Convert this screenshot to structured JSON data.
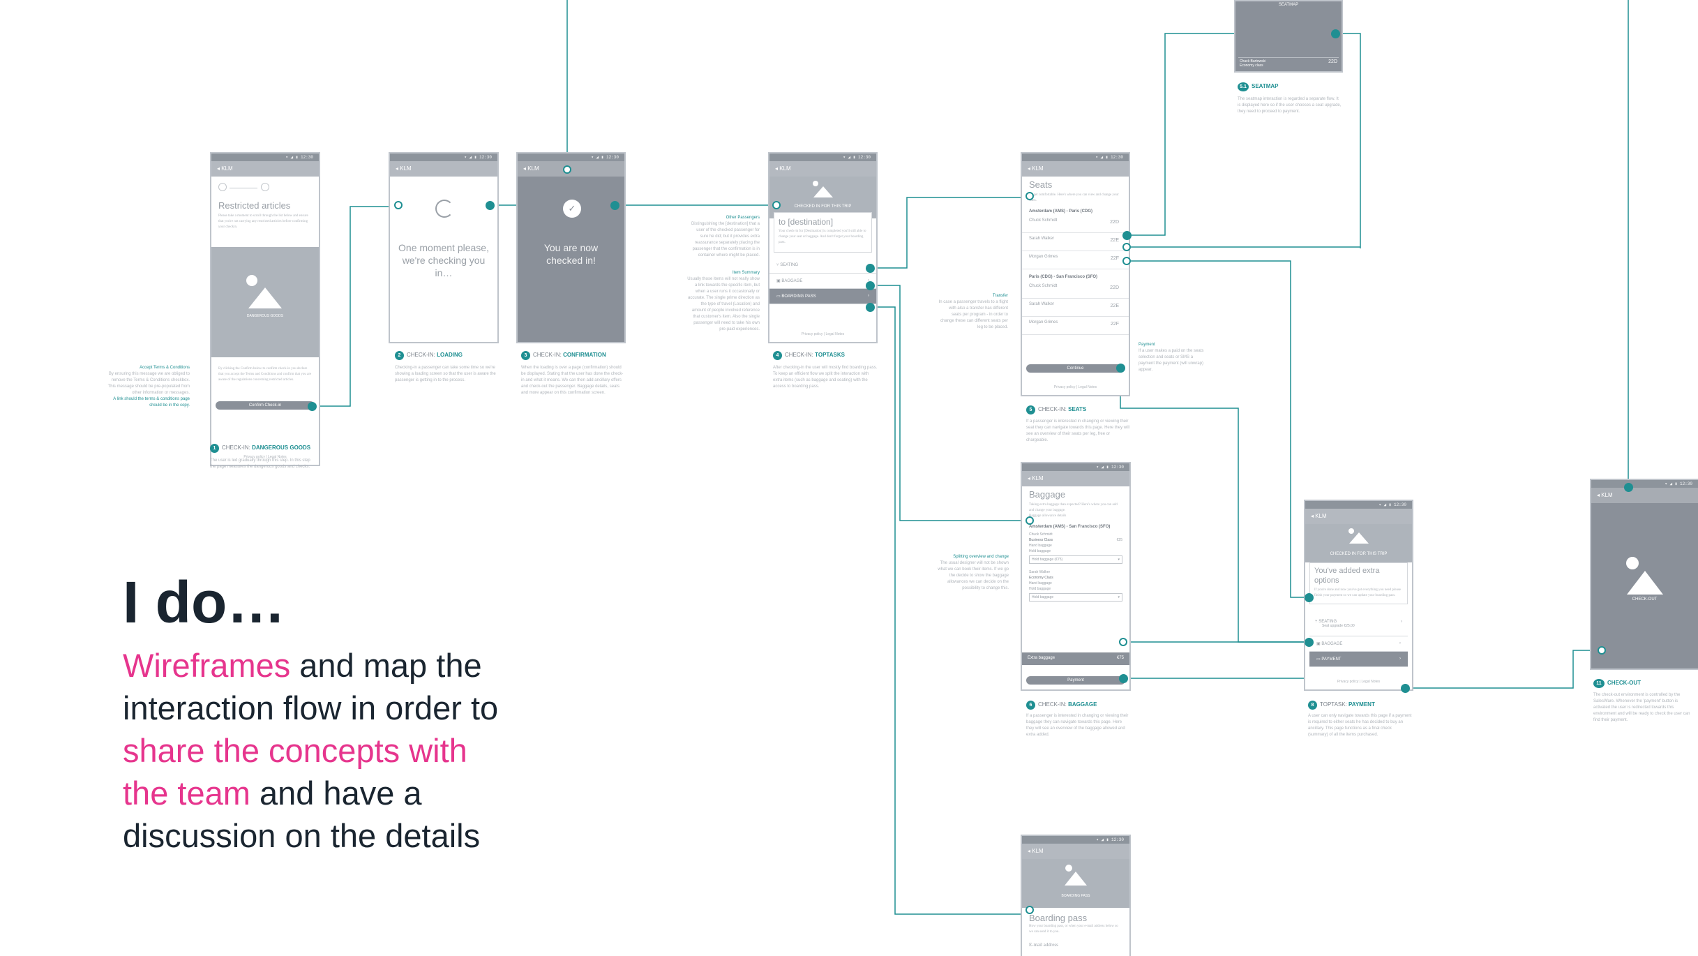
{
  "headline": "I do…",
  "pitch": {
    "p1": "Wireframes",
    "p2": " and map the interaction flow in order to ",
    "p3": "share the concepts with the team",
    "p4": " and have a discussion on the details"
  },
  "colors": {
    "accent": "#1f8f92",
    "pink": "#e6358d",
    "ink": "#1a2530",
    "grey": "#8a9099"
  },
  "app": {
    "back": "◂ KLM",
    "status": "▾ ◢ ▮ 12:30"
  },
  "screens": {
    "dangerous": {
      "title": "Restricted articles",
      "intro": "Please take a moment to scroll through the list below and ensure that you're not carrying any restricted articles before confirming your checkin.",
      "image_label": "DANGEROUS GOODS",
      "body": "By clicking the Confirm below to confirm check-in you declare that you accept the Terms and Conditions and confirm that you are aware of the regulations concerning restricted articles.",
      "button": "Confirm Check-in",
      "footer": "Privacy policy | Legal Notes",
      "num": "1",
      "label": "CHECK-IN: ",
      "label_b": "DANGEROUS GOODS",
      "desc": "The user is led gradually through this step. In this step the page measures the dangerous goods and checks."
    },
    "loading": {
      "text": "One moment please, we're checking you in…",
      "num": "2",
      "label": "CHECK-IN: ",
      "label_b": "LOADING",
      "desc": "Checking-in a passenger can take some time so we're showing a loading screen so that the user is aware the passenger is getting in to the process."
    },
    "confirmation": {
      "text": "You are now checked in!",
      "num": "3",
      "label": "CHECK-IN: ",
      "label_b": "CONFIRMATION",
      "desc": "When the loading is over a page (confirmation) should be displayed. Stating that the user has done the check-in and what it means. We can then add ancillary offers and check-out the passenger. Baggage details, seats and more appear on this confirmation screen."
    },
    "toptasks": {
      "header": "CHECKED IN FOR THIS TRIP",
      "dest": "to [destination]",
      "intro": "Your check-in for [Destination] is completed you'll still able to change your seat or baggage. And don't forget your boarding pass.",
      "rows": [
        "SEATING",
        "BAGGAGE",
        "BOARDING PASS"
      ],
      "footer": "Privacy policy | Legal Notes",
      "num": "4",
      "label": "CHECK-IN: ",
      "label_b": "TOPTASKS",
      "desc": "After checking-in the user will mostly find boarding pass. To keep an efficient flow we split the interaction with extra items (such as baggage and seating) with the access to boarding pass."
    },
    "seats": {
      "title": "Seats",
      "intro": "To get comfortable. Here's where you can view and change your seats.",
      "leg1": "Amsterdam (AMS) - Paris (CDG)",
      "leg2": "Paris (CDG) - San Francisco (SFO)",
      "pax": [
        "Chuck Schmidt",
        "Sarah Walker",
        "Morgan Grimes"
      ],
      "pax_sub": "Economy class",
      "seat1": [
        "22D",
        "22E",
        "22F"
      ],
      "seat2": [
        "22D",
        "22E",
        "22F"
      ],
      "button": "Continue",
      "footer": "Privacy policy | Legal Notes",
      "num": "5",
      "label": "CHECK-IN: ",
      "label_b": "SEATS",
      "desc": "If a passenger is interested in changing or viewing their seat they can navigate towards this page. Here they will see an overview of their seats per leg, free or chargeable."
    },
    "seatmap": {
      "header": "SEATMAP",
      "row_name": "Chuck Bartowski",
      "row_sub": "Economy class",
      "row_seat": "22D",
      "num": "5.1",
      "label": "",
      "label_b": "SEATMAP",
      "desc": "The seatmap interaction is regarded a separate flow. It is displayed here so if the user chooses a seat upgrade, they need to proceed to payment."
    },
    "baggage": {
      "title": "Baggage",
      "intro": "Taking extra baggage than expected? Here's where you can add and change your baggage.",
      "link": "Baggage allowance details",
      "leg1": "Amsterdam (AMS) - San Francisco (SFO)",
      "pax1": "Chuck Schmidt",
      "class1": "Business Class",
      "price1": "€25",
      "allow1": "Hand baggage",
      "allow2": "Hold baggage",
      "select1": "Hold baggage (€75)",
      "pax2": "Sarah Walker",
      "class2": "Economy Class",
      "select2": "Hold baggage",
      "total_label": "Extra baggage",
      "total": "€75",
      "button": "Payment",
      "num": "6",
      "label": "CHECK-IN: ",
      "label_b": "BAGGAGE",
      "desc": "If a passenger is interested in changing or viewing their baggage they can navigate towards this page. Here they will see an overview of the baggage allowed and extra added."
    },
    "boarding": {
      "image_label": "BOARDING PASS",
      "title": "Boarding pass",
      "intro": "How your boarding pass, or when your e-mail address below so we can send it to you.",
      "email": "E-mail address"
    },
    "payment": {
      "header": "CHECKED IN FOR THIS TRIP",
      "title": "You've added extra options",
      "intro": "If you're done and now you've got everything you need please finish your payment so we can update your boarding pass.",
      "rows": [
        "SEATING",
        "BAGGAGE",
        "PAYMENT"
      ],
      "seat_sub": "Seat upgrade €25.00",
      "footer": "Privacy policy | Legal Notes",
      "num": "8",
      "label": "TOPTASK: ",
      "label_b": "PAYMENT",
      "desc": "A user can only navigate towards this page if a payment is required to either seats he has decided to buy an ancillary. This page functions as a final check (summary) of all the items purchased."
    },
    "checkout": {
      "image_label": "CHECK-OUT",
      "num": "11",
      "label": "",
      "label_b": "CHECK-OUT",
      "desc": "The check-out environment is controlled by the SalesWare. Whenever the 'payment' button is activated the user is redirected towards this environment and will be ready to check the user can find their payment."
    }
  },
  "notes": {
    "terms_title": "Accept Terms & Conditions",
    "terms_text": "By ensuring this message we are obliged to remove the Terms & Conditions checkbox. This message should be pre-populated from other information or messages.",
    "terms_em": "A link should the terms & conditions page should be in the copy.",
    "other_title": "Other Passengers",
    "other_text": "Distinguishing the [destination] that a user of the checked passenger for sure he did; but it provides extra reassurance separately placing the passenger that the confirmation is in container where might be placed.",
    "summary_title": "Item Summary",
    "summary_text": "Usually those items will not really show a link towards the specific item, but when a user runs it occasionally or accurate. The single prime direction as the type of travel (Location) and amount of people involved reference that customer's item. Also the single passenger will need to take his own pre-paid experiences.",
    "transfer_title": "Transfer",
    "transfer_text": "In case a passenger travels to a flight with also a transfer has different seats per program - in order to change these can different seats per leg to be placed.",
    "payment_title": "Payment",
    "payment_text": "If a user makes a paid on the seats selection and seats or SMS a payment the payment (will unwrap) appear.",
    "split_title": "Splitting overview and change",
    "split_text": "The usual designer will not be shown what we can book their items. If we go the decide to show the baggage allowances we can decide on the possibility to change this."
  }
}
